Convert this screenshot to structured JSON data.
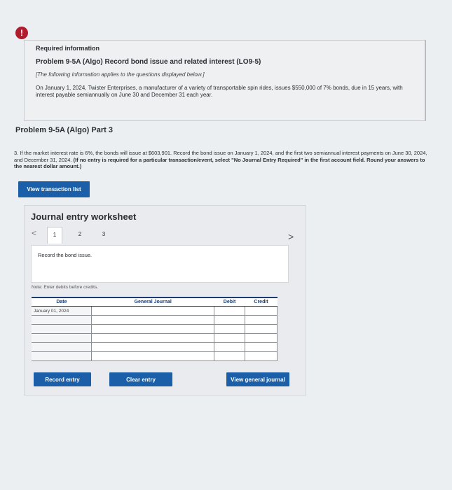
{
  "alert_icon": "!",
  "info": {
    "heading": "Required information",
    "problem_title": "Problem 9-5A (Algo) Record bond issue and related interest (LO9-5)",
    "note": "[The following information applies to the questions displayed below.]",
    "body": "On January 1, 2024, Twister Enterprises, a manufacturer of a variety of transportable spin rides, issues $550,000 of 7% bonds, due in 15 years, with interest payable semiannually on June 30 and December 31 each year."
  },
  "part_title": "Problem 9-5A (Algo) Part 3",
  "question": {
    "text": "3. If the market interest rate is 6%, the bonds will issue at $603,901. Record the bond issue on January 1, 2024, and the first two semiannual interest payments on June 30, 2024, and December 31, 2024.",
    "bold": "(If no entry is required for a particular transaction/event, select \"No Journal Entry Required\" in the first account field. Round your answers to the nearest dollar amount.)"
  },
  "buttons": {
    "view_transaction_list": "View transaction list",
    "record_entry": "Record entry",
    "clear_entry": "Clear entry",
    "view_general_journal": "View general journal"
  },
  "worksheet": {
    "title": "Journal entry worksheet",
    "prev_arrow": "<",
    "next_arrow": ">",
    "tabs": [
      "1",
      "2",
      "3"
    ],
    "active_tab": "1",
    "description": "Record the bond issue.",
    "note": "Note: Enter debits before credits.",
    "columns": [
      "Date",
      "General Journal",
      "Debit",
      "Credit"
    ],
    "rows": [
      {
        "date": "January 01, 2024",
        "account": "",
        "debit": "",
        "credit": ""
      },
      {
        "date": "",
        "account": "",
        "debit": "",
        "credit": ""
      },
      {
        "date": "",
        "account": "",
        "debit": "",
        "credit": ""
      },
      {
        "date": "",
        "account": "",
        "debit": "",
        "credit": ""
      },
      {
        "date": "",
        "account": "",
        "debit": "",
        "credit": ""
      },
      {
        "date": "",
        "account": "",
        "debit": "",
        "credit": ""
      }
    ]
  },
  "colors": {
    "button_blue": "#1a5fa8",
    "alert_red": "#b01c2e",
    "header_navy": "#1a3c6e"
  }
}
